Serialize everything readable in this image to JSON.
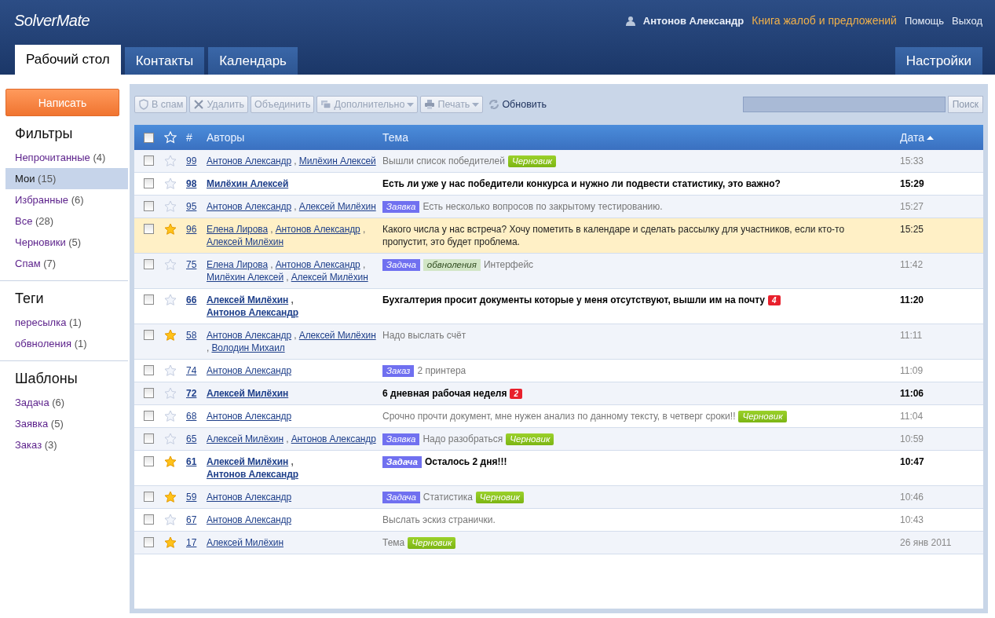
{
  "header": {
    "logo": "SolverMate",
    "user": "Антонов Александр",
    "links": [
      {
        "label": "Книга жалоб и предложений",
        "kind": "accent"
      },
      {
        "label": "Помощь",
        "kind": "plain"
      },
      {
        "label": "Выход",
        "kind": "plain"
      }
    ]
  },
  "tabs": [
    {
      "label": "Рабочий стол",
      "selected": true
    },
    {
      "label": "Контакты",
      "selected": false
    },
    {
      "label": "Календарь",
      "selected": false
    }
  ],
  "settings_tab": "Настройки",
  "sidebar": {
    "compose": "Написать",
    "sections": [
      {
        "title": "Фильтры",
        "items": [
          {
            "label": "Непрочитанные",
            "count": "(4)",
            "selected": false
          },
          {
            "label": "Мои",
            "count": "(15)",
            "selected": true
          },
          {
            "label": "Избранные",
            "count": "(6)",
            "selected": false
          },
          {
            "label": "Все",
            "count": "(28)",
            "selected": false
          },
          {
            "label": "Черновики",
            "count": "(5)",
            "selected": false
          },
          {
            "label": "Спам",
            "count": "(7)",
            "selected": false
          }
        ]
      },
      {
        "title": "Теги",
        "items": [
          {
            "label": "пересылка",
            "count": "(1)",
            "selected": false
          },
          {
            "label": "обвноления",
            "count": "(1)",
            "selected": false
          }
        ]
      },
      {
        "title": "Шаблоны",
        "items": [
          {
            "label": "Задача",
            "count": "(6)",
            "selected": false
          },
          {
            "label": "Заявка",
            "count": "(5)",
            "selected": false
          },
          {
            "label": "Заказ",
            "count": "(3)",
            "selected": false
          }
        ]
      }
    ]
  },
  "toolbar": {
    "buttons": [
      {
        "label": "В спам",
        "dropdown": false,
        "disabled": true
      },
      {
        "label": "Удалить",
        "dropdown": false,
        "disabled": true
      },
      {
        "label": "Объединить",
        "dropdown": false,
        "disabled": true
      },
      {
        "label": "Дополнительно",
        "dropdown": true,
        "disabled": true
      },
      {
        "label": "Печать",
        "dropdown": true,
        "disabled": true
      },
      {
        "label": "Обновить",
        "dropdown": false,
        "disabled": false
      }
    ],
    "search_button": "Поиск"
  },
  "table": {
    "select_all_checked": false,
    "author_separator": ",",
    "columns": {
      "number": "#",
      "authors": "Авторы",
      "subject": "Тема",
      "date": "Дата"
    },
    "rows": [
      {
        "number": "99",
        "authors": [
          "Антонов Александр",
          "Милёхин Алексей"
        ],
        "unread": false,
        "starred": false,
        "selected": false,
        "checked": false,
        "subject": [
          {
            "kind": "text",
            "text": "Вышли список победителей"
          },
          {
            "kind": "draft",
            "text": "Черновик"
          }
        ],
        "date": "15:33"
      },
      {
        "number": "98",
        "authors": [
          "Милёхин Алексей"
        ],
        "unread": true,
        "starred": false,
        "selected": false,
        "checked": false,
        "subject": [
          {
            "kind": "text",
            "text": "Есть ли уже у нас победители конкурса и нужно ли подвести статистику, это важно?"
          }
        ],
        "date": "15:29"
      },
      {
        "number": "95",
        "authors": [
          "Антонов Александр",
          "Алексей Милёхин"
        ],
        "unread": false,
        "starred": false,
        "selected": false,
        "checked": false,
        "subject": [
          {
            "kind": "category",
            "text": "Заявка"
          },
          {
            "kind": "text",
            "text": "Есть несколько вопросов по закрытому тестированию."
          }
        ],
        "date": "15:27"
      },
      {
        "number": "96",
        "authors": [
          "Елена Лирова",
          "Антонов Александр",
          "Алексей Милёхин"
        ],
        "unread": false,
        "starred": true,
        "selected": true,
        "checked": false,
        "subject": [
          {
            "kind": "text",
            "text": "Какого числа у нас встреча? Хочу пометить в календаре и сделать рассылку для участников, если кто-то пропустит, это будет проблема."
          }
        ],
        "date": "15:25"
      },
      {
        "number": "75",
        "authors": [
          "Елена Лирова",
          "Антонов Александр",
          "Милёхин Алексей",
          "Алексей Милёхин"
        ],
        "unread": false,
        "starred": false,
        "selected": false,
        "checked": false,
        "subject": [
          {
            "kind": "category",
            "text": "Задача"
          },
          {
            "kind": "tag",
            "text": "обвноления"
          },
          {
            "kind": "text",
            "text": "Интерфейс"
          }
        ],
        "date": "11:42"
      },
      {
        "number": "66",
        "authors": [
          "Алексей Милёхин",
          "Антонов Александр"
        ],
        "unread": true,
        "starred": false,
        "selected": false,
        "checked": false,
        "subject": [
          {
            "kind": "text",
            "text": "Бухгалтерия просит документы которые у меня отсутствуют, вышли им на почту"
          },
          {
            "kind": "comments",
            "text": "4"
          }
        ],
        "date": "11:20"
      },
      {
        "number": "58",
        "authors": [
          "Антонов Александр",
          "Алексей Милёхин",
          "Володин Михаил"
        ],
        "unread": false,
        "starred": true,
        "selected": false,
        "checked": false,
        "subject": [
          {
            "kind": "text",
            "text": "Надо выслать счёт"
          }
        ],
        "date": "11:11"
      },
      {
        "number": "74",
        "authors": [
          "Антонов Александр"
        ],
        "unread": false,
        "starred": false,
        "selected": false,
        "checked": false,
        "subject": [
          {
            "kind": "category",
            "text": "Заказ"
          },
          {
            "kind": "text",
            "text": "2 принтера"
          }
        ],
        "date": "11:09"
      },
      {
        "number": "72",
        "authors": [
          "Алексей Милёхин"
        ],
        "unread": true,
        "starred": false,
        "selected": false,
        "checked": false,
        "subject": [
          {
            "kind": "text",
            "text": "6 дневная рабочая неделя"
          },
          {
            "kind": "comments",
            "text": "2"
          }
        ],
        "date": "11:06"
      },
      {
        "number": "68",
        "authors": [
          "Антонов Александр"
        ],
        "unread": false,
        "starred": false,
        "selected": false,
        "checked": false,
        "subject": [
          {
            "kind": "text",
            "text": "Срочно прочти документ, мне нужен анализ по данному тексту, в четверг сроки!!"
          },
          {
            "kind": "draft",
            "text": "Черновик"
          }
        ],
        "date": "11:04"
      },
      {
        "number": "65",
        "authors": [
          "Алексей Милёхин",
          "Антонов Александр"
        ],
        "unread": false,
        "starred": false,
        "selected": false,
        "checked": false,
        "subject": [
          {
            "kind": "category",
            "text": "Заявка"
          },
          {
            "kind": "text",
            "text": "Надо разобраться"
          },
          {
            "kind": "draft",
            "text": "Черновик"
          }
        ],
        "date": "10:59"
      },
      {
        "number": "61",
        "authors": [
          "Алексей Милёхин",
          "Антонов Александр"
        ],
        "unread": true,
        "starred": true,
        "selected": false,
        "checked": false,
        "subject": [
          {
            "kind": "category",
            "text": "Задача"
          },
          {
            "kind": "text",
            "text": "Осталось 2 дня!!!"
          }
        ],
        "date": "10:47"
      },
      {
        "number": "59",
        "authors": [
          "Антонов Александр"
        ],
        "unread": false,
        "starred": true,
        "selected": false,
        "checked": false,
        "subject": [
          {
            "kind": "category",
            "text": "Задача"
          },
          {
            "kind": "text",
            "text": "Статистика"
          },
          {
            "kind": "draft",
            "text": "Черновик"
          }
        ],
        "date": "10:46"
      },
      {
        "number": "67",
        "authors": [
          "Антонов Александр"
        ],
        "unread": false,
        "starred": false,
        "selected": false,
        "checked": false,
        "subject": [
          {
            "kind": "text",
            "text": "Выслать эскиз странички."
          }
        ],
        "date": "10:43"
      },
      {
        "number": "17",
        "authors": [
          "Алексей Милёхин"
        ],
        "unread": false,
        "starred": true,
        "selected": false,
        "checked": false,
        "subject": [
          {
            "kind": "text",
            "text": "Тема"
          },
          {
            "kind": "draft",
            "text": "Черновик"
          }
        ],
        "date": "26 янв 2011"
      }
    ]
  }
}
